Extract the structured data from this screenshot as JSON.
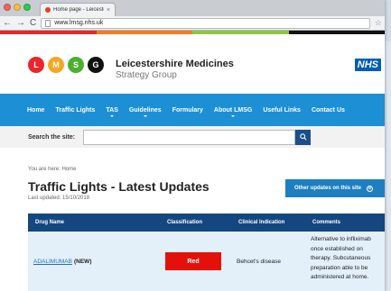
{
  "browser": {
    "tab_title": "Home page - Leicestersh",
    "tab_close": "×",
    "url": "www.lmsg.nhs.uk",
    "back": "←",
    "forward": "→",
    "reload": "C",
    "star": "☆"
  },
  "color_band": [
    "#e8262b",
    "#f47b20",
    "#8dc63f",
    "#111111"
  ],
  "logo": {
    "circles": [
      {
        "letter": "L",
        "color": "#e8262b"
      },
      {
        "letter": "M",
        "color": "#f6a623"
      },
      {
        "letter": "S",
        "color": "#4caf2e"
      },
      {
        "letter": "G",
        "color": "#111111"
      }
    ],
    "title": "Leicestershire Medicines",
    "subtitle": "Strategy Group",
    "nhs": "NHS"
  },
  "nav": {
    "items": [
      {
        "label": "Home",
        "dropdown": false
      },
      {
        "label": "Traffic Lights",
        "dropdown": false
      },
      {
        "label": "TAS",
        "dropdown": true
      },
      {
        "label": "Guidelines",
        "dropdown": true
      },
      {
        "label": "Formulary",
        "dropdown": false
      },
      {
        "label": "About LMSG",
        "dropdown": true
      },
      {
        "label": "Useful Links",
        "dropdown": false
      },
      {
        "label": "Contact Us",
        "dropdown": false
      }
    ]
  },
  "search": {
    "label": "Search the site:",
    "value": "",
    "placeholder": ""
  },
  "breadcrumb": "You are here: Home",
  "page": {
    "title": "Traffic Lights - Latest Updates",
    "updated": "Last updated: 15/10/2018",
    "other_updates_label": "Other updates on this site",
    "other_updates_icon": "⊙"
  },
  "table": {
    "headers": [
      "Drug Name",
      "Classification",
      "Clinical Indication",
      "Comments"
    ],
    "rows": [
      {
        "drug": "ADALIMUMAB",
        "tag": "(NEW)",
        "classification": "Red",
        "classification_color": "#e4110a",
        "indication": "Behcet's disease",
        "comments": "Alternative to infliximab once established on therapy. Subcutaneous preparation able to be administered at home."
      }
    ]
  }
}
